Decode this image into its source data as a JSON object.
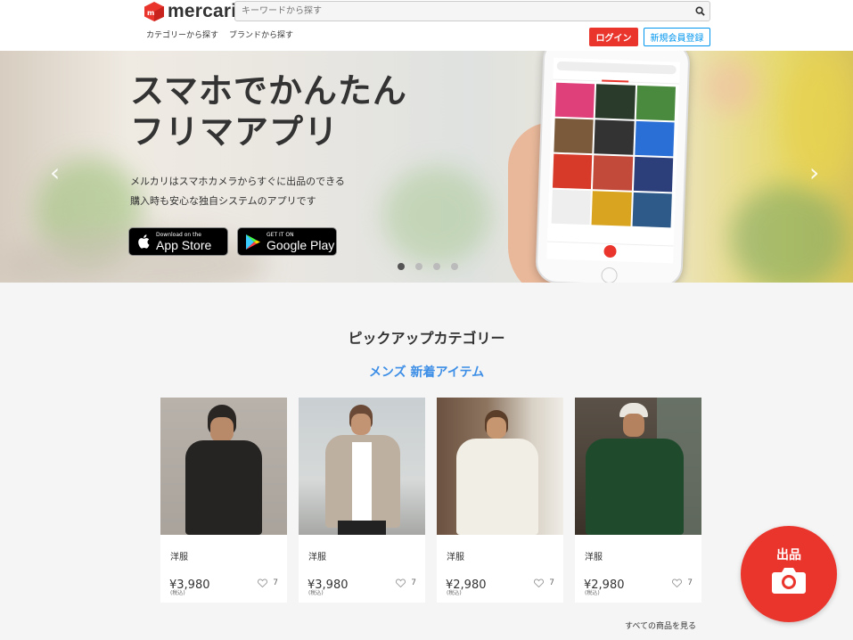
{
  "header": {
    "logo_text": "mercari",
    "search_placeholder": "キーワードから探す",
    "category_link": "カテゴリーから探す",
    "brand_link": "ブランドから探す",
    "login_label": "ログイン",
    "signup_label": "新規会員登録"
  },
  "hero": {
    "title_line1": "スマホでかんたん",
    "title_line2": "フリマアプリ",
    "desc_line1": "メルカリはスマホカメラからすぐに出品のできる",
    "desc_line2": "購入時も安心な独自システムのアプリです",
    "appstore_small": "Download on the",
    "appstore_big": "App Store",
    "googleplay_small": "GET IT ON",
    "googleplay_big": "Google Play",
    "slide_count": 4,
    "active_slide": 1
  },
  "pickup": {
    "title": "ピックアップカテゴリー",
    "subtitle": "メンズ 新着アイテム",
    "items": [
      {
        "name": "洋服",
        "price": "¥3,980",
        "tax": "(税込)",
        "likes": "7"
      },
      {
        "name": "洋服",
        "price": "¥3,980",
        "tax": "(税込)",
        "likes": "7"
      },
      {
        "name": "洋服",
        "price": "¥2,980",
        "tax": "(税込)",
        "likes": "7"
      },
      {
        "name": "洋服",
        "price": "¥2,980",
        "tax": "(税込)",
        "likes": "7"
      }
    ],
    "see_all": "すべての商品を見る"
  },
  "sell_button": {
    "label": "出品"
  },
  "colors": {
    "brand_red": "#ea352d",
    "link_blue": "#3d8ee6",
    "signup_blue": "#0095ee"
  }
}
